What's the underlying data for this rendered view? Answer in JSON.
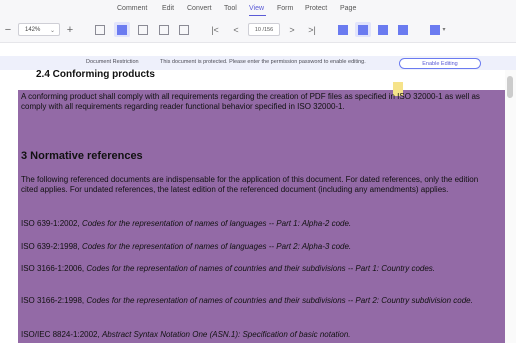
{
  "menu": {
    "items": [
      "Comment",
      "Edit",
      "Convert",
      "Tool",
      "View",
      "Form",
      "Protect",
      "Page"
    ],
    "active": "View"
  },
  "toolbar": {
    "zoom_out": "−",
    "zoom_value": "142%",
    "zoom_in": "+",
    "first_page": "|<",
    "prev_page": "<",
    "page_value": "10 /156",
    "next_page": ">",
    "last_page": ">|"
  },
  "restriction": {
    "title": "Document Restriction",
    "message": "This document is protected. Please enter the permission password to enable editing.",
    "button": "Enable Editing"
  },
  "document": {
    "section_2_4": "2.4   Conforming products",
    "p1": "A conforming product shall comply with all requirements regarding the creation of PDF files as specified in ISO 32000-1 as well as comply with all requirements regarding reader functional behavior specified in ISO 32000-1.",
    "section_3": "3      Normative references",
    "p2": "The following referenced documents are indispensable for the application of this document. For dated references, only the edition cited applies. For undated references, the latest edition of the referenced document (including any amendments) applies.",
    "refs": [
      {
        "id": "ISO 639-1:2002,",
        "title": "Codes for the representation of names of languages -- Part 1: Alpha-2 code."
      },
      {
        "id": "ISO 639-2:1998,",
        "title": "Codes for the representation of names of languages -- Part 2: Alpha-3 code."
      },
      {
        "id": "ISO 3166-1:2006,",
        "title": "Codes for the representation of names of countries and their subdivisions -- Part 1: Country codes."
      },
      {
        "id": "ISO 3166-2:1998,",
        "title": "Codes for the representation of names of countries and their subdivisions -- Part 2: Country subdivision code."
      },
      {
        "id": "ISO/IEC 8824-1:2002,",
        "title": "Abstract Syntax Notation One (ASN.1): Specification of basic notation."
      }
    ]
  },
  "colors": {
    "accent": "#5b5bd6",
    "overlay": "#8050a0"
  }
}
